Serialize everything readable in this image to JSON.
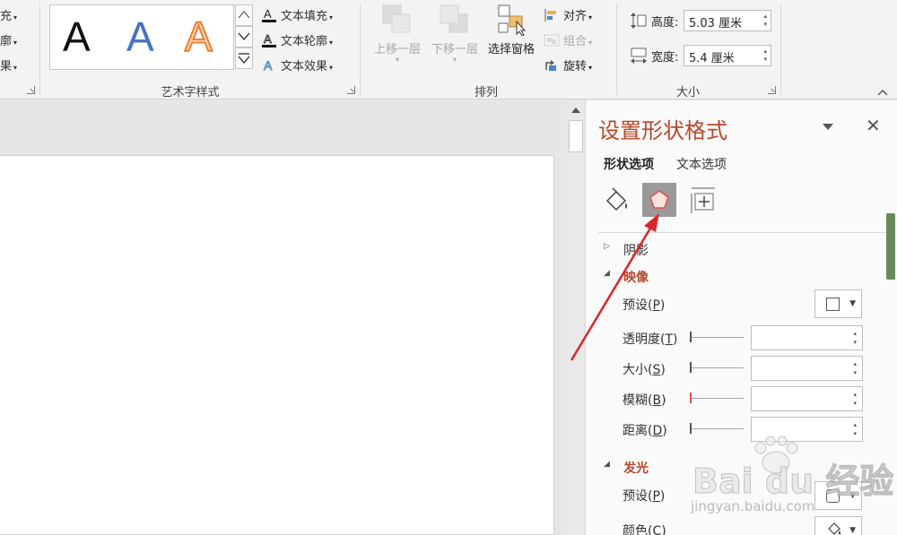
{
  "ribbon": {
    "cut_items": [
      {
        "label": "充",
        "dropdown": true
      },
      {
        "label": "廓",
        "dropdown": true
      },
      {
        "label": "果",
        "dropdown": true
      }
    ],
    "wordart": {
      "samples": [
        "A",
        "A",
        "A"
      ],
      "text_fill": "文本填充",
      "text_outline": "文本轮廓",
      "text_effects": "文本效果",
      "group_label": "艺术字样式"
    },
    "arrange": {
      "bring_forward": "上移一层",
      "send_backward": "下移一层",
      "selection_pane": "选择窗格",
      "align": "对齐",
      "group": "组合",
      "rotate": "旋转",
      "group_label": "排列"
    },
    "size": {
      "height_label": "高度:",
      "height_value": "5.03 厘米",
      "width_label": "宽度:",
      "width_value": "5.4 厘米",
      "group_label": "大小"
    }
  },
  "pane": {
    "title": "设置形状格式",
    "tabs": [
      "形状选项",
      "文本选项"
    ],
    "category_icons": [
      "fill-line-icon",
      "effects-icon",
      "size-properties-icon"
    ],
    "sections": {
      "shadow": "阴影",
      "reflection": "映像",
      "glow": "发光"
    },
    "reflection_props": {
      "preset": {
        "text": "预设(",
        "key": "P",
        "tail": ")"
      },
      "transparency": {
        "text": "透明度(",
        "key": "T",
        "tail": ")"
      },
      "size": {
        "text": "大小(",
        "key": "S",
        "tail": ")"
      },
      "blur": {
        "text": "模糊(",
        "key": "B",
        "tail": ")"
      },
      "distance": {
        "text": "距离(",
        "key": "D",
        "tail": ")"
      }
    },
    "glow_props": {
      "preset": {
        "text": "预设(",
        "key": "P",
        "tail": ")"
      },
      "color": {
        "text": "颜色(",
        "key": "C",
        "tail": ")"
      }
    }
  },
  "watermark": {
    "main": "Bai du 经验",
    "sub": "jingyan.baidu.com"
  },
  "colors": {
    "accent": "#b7472a",
    "annotation": "#d9262a"
  }
}
